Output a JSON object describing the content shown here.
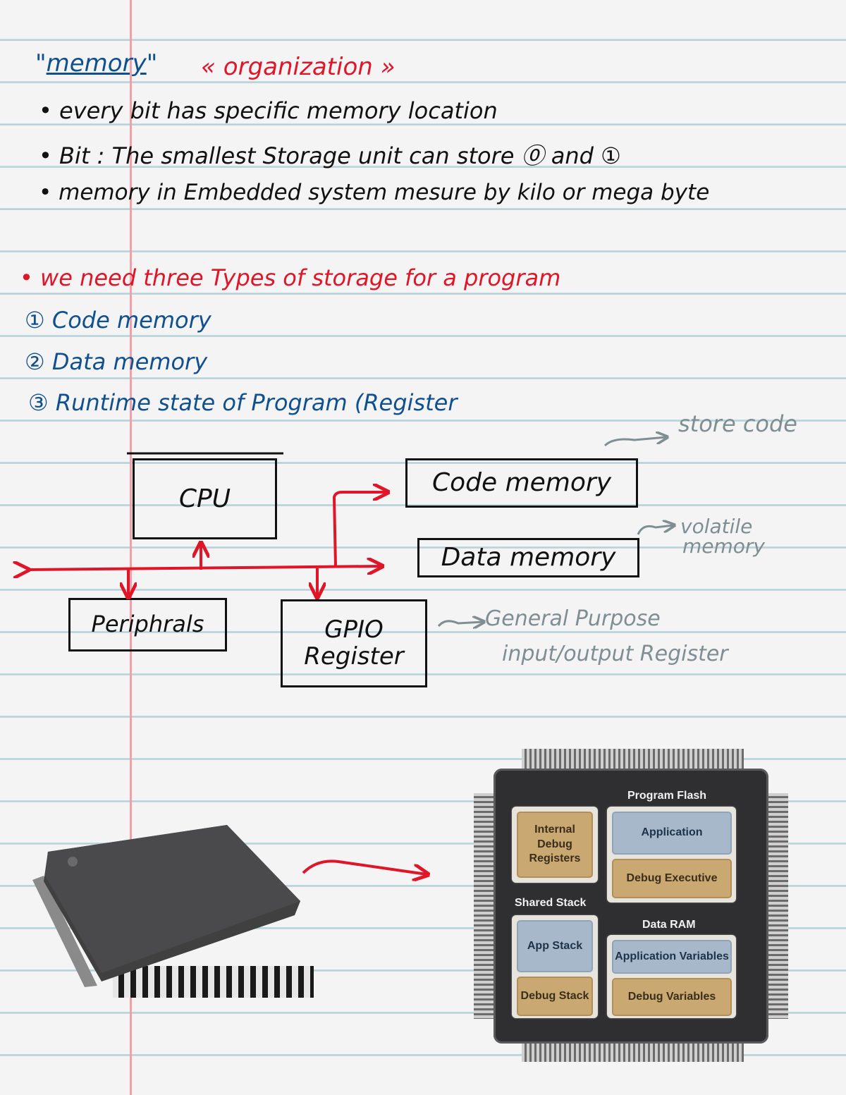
{
  "heading": {
    "quote_open": "\"",
    "word": "memory",
    "quote_close": "\"",
    "subtitle": "« organization »"
  },
  "bullets": [
    "• every bit has specific memory location",
    "• Bit : The smallest Storage unit can store ⓪ and ①",
    "• memory in Embedded system mesure by kilo or mega byte"
  ],
  "storage_heading": "• we need three Types of storage for a program",
  "storage_types": [
    "① Code memory",
    "② Data memory",
    "③ Runtime state of Program (Register"
  ],
  "diagram": {
    "blocks": {
      "cpu": "CPU",
      "code_memory": "Code memory",
      "data_memory": "Data memory",
      "peripherals": "Periphrals",
      "gpio_line1": "GPIO",
      "gpio_line2": "Register"
    },
    "annotations": {
      "store_code": "store code",
      "volatile_line1": "volatile",
      "volatile_line2": "memory",
      "gpio_desc_line1": "General Purpose",
      "gpio_desc_line2": "input/output Register"
    }
  },
  "chip_diagram": {
    "program_flash": "Program Flash",
    "application": "Application",
    "debug_executive": "Debug Executive",
    "internal_debug_registers": "Internal Debug Registers",
    "shared_stack": "Shared Stack",
    "app_stack": "App Stack",
    "debug_stack": "Debug Stack",
    "data_ram": "Data RAM",
    "application_variables": "Application Variables",
    "debug_variables": "Debug Variables"
  },
  "colors": {
    "ink_blue": "#10508f",
    "ink_red": "#e01528",
    "ink_gray": "#7f8e93",
    "rule": "#b7d3da",
    "margin": "#f0a0a8"
  }
}
